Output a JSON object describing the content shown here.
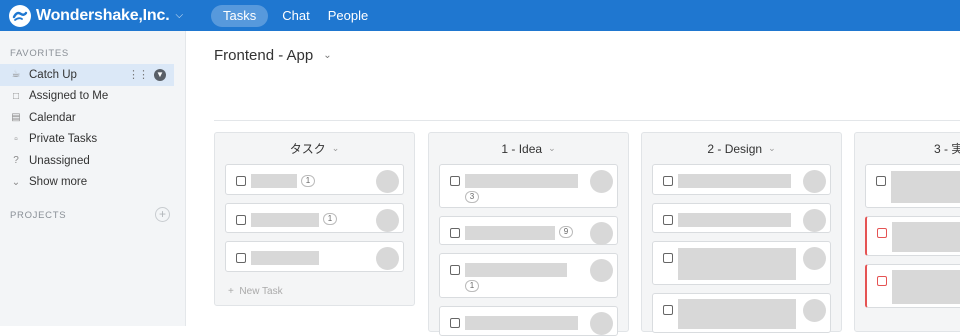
{
  "topbar": {
    "brand": "Wondershake,Inc.",
    "tabs": [
      {
        "label": "Tasks"
      },
      {
        "label": "Chat"
      },
      {
        "label": "People"
      }
    ]
  },
  "sidebar": {
    "favorites_title": "FAVORITES",
    "items": [
      {
        "label": "Catch Up",
        "icon": "coffee-icon"
      },
      {
        "label": "Assigned to Me",
        "icon": "clipboard-icon"
      },
      {
        "label": "Calendar",
        "icon": "calendar-icon"
      },
      {
        "label": "Private Tasks",
        "icon": "lock-icon"
      },
      {
        "label": "Unassigned",
        "icon": "question-icon"
      },
      {
        "label": "Show more",
        "icon": "chevron-down-icon"
      }
    ],
    "projects_title": "PROJECTS"
  },
  "main": {
    "project_title": "Frontend - App",
    "columns": [
      {
        "title": "タスク",
        "new_task": "New Task",
        "badges": [
          "1",
          "1"
        ]
      },
      {
        "title": "1 - Idea",
        "badges": [
          "3",
          "9",
          "1"
        ]
      },
      {
        "title": "2 - Design"
      },
      {
        "title": "3 - 実"
      }
    ]
  },
  "colors": {
    "accent": "#1f77d0",
    "danger": "#e55353",
    "placeholder": "#d8d8d8"
  }
}
